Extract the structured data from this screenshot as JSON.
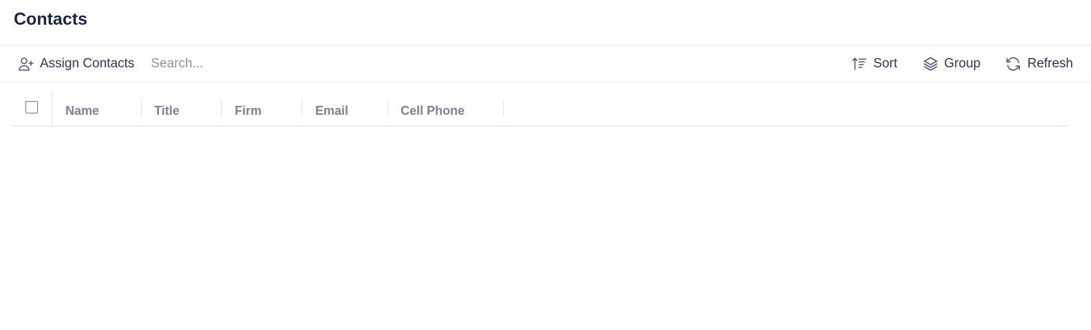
{
  "header": {
    "title": "Contacts"
  },
  "toolbar": {
    "assign_label": "Assign Contacts",
    "search_placeholder": "Search...",
    "sort_label": "Sort",
    "group_label": "Group",
    "refresh_label": "Refresh"
  },
  "grid": {
    "columns": [
      {
        "label": "Name"
      },
      {
        "label": "Title"
      },
      {
        "label": "Firm"
      },
      {
        "label": "Email"
      },
      {
        "label": "Cell Phone"
      }
    ],
    "rows": []
  },
  "icons": {
    "assign": "user-plus-icon",
    "sort": "sort-ascending-icon",
    "group": "layers-icon",
    "refresh": "refresh-icon"
  }
}
